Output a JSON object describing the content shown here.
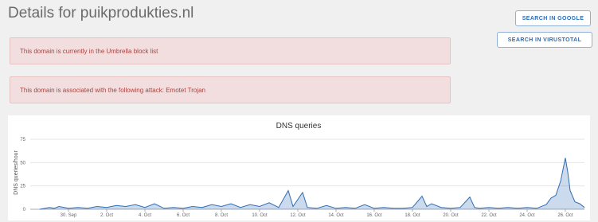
{
  "page": {
    "title": "Details for puikprodukties.nl"
  },
  "buttons": {
    "google": "SEARCH IN GOOGLE",
    "virustotal": "SEARCH IN VIRUSTOTAL"
  },
  "alerts": [
    "This domain is currently in the Umbrella block list",
    "This domain is associated with the following attack: Emotet Trojan"
  ],
  "colors": {
    "alert_bg": "#f2dede",
    "alert_text": "#a94442",
    "button_text": "#2a6db8",
    "series": "#2f6db5"
  },
  "chart_data": {
    "type": "area",
    "title": "DNS queries",
    "xlabel": "",
    "ylabel": "DNS queries/hour",
    "ylim": [
      0,
      75
    ],
    "yticks": [
      0,
      25,
      50,
      75
    ],
    "xlim": [
      "2019-09-28",
      "2019-10-27"
    ],
    "xticks": [
      "30. Sep",
      "2. Oct",
      "4. Oct",
      "6. Oct",
      "8. Oct",
      "10. Oct",
      "12. Oct",
      "14. Oct",
      "16. Oct",
      "18. Oct",
      "20. Oct",
      "22. Oct",
      "24. Oct",
      "26. Oct"
    ],
    "grid": true,
    "legend": "none",
    "series": [
      {
        "values": [
          [
            "2019-09-28T12:00",
            0
          ],
          [
            "2019-09-29T00:00",
            2
          ],
          [
            "2019-09-29T06:00",
            1
          ],
          [
            "2019-09-29T12:00",
            3
          ],
          [
            "2019-09-30T00:00",
            1
          ],
          [
            "2019-09-30T12:00",
            2
          ],
          [
            "2019-10-01T00:00",
            1
          ],
          [
            "2019-10-01T12:00",
            3
          ],
          [
            "2019-10-02T00:00",
            2
          ],
          [
            "2019-10-02T12:00",
            4
          ],
          [
            "2019-10-03T00:00",
            3
          ],
          [
            "2019-10-03T12:00",
            5
          ],
          [
            "2019-10-04T00:00",
            2
          ],
          [
            "2019-10-04T12:00",
            6
          ],
          [
            "2019-10-05T00:00",
            1
          ],
          [
            "2019-10-05T12:00",
            2
          ],
          [
            "2019-10-06T00:00",
            1
          ],
          [
            "2019-10-06T12:00",
            3
          ],
          [
            "2019-10-07T00:00",
            2
          ],
          [
            "2019-10-07T12:00",
            5
          ],
          [
            "2019-10-08T00:00",
            3
          ],
          [
            "2019-10-08T12:00",
            6
          ],
          [
            "2019-10-09T00:00",
            2
          ],
          [
            "2019-10-09T12:00",
            5
          ],
          [
            "2019-10-10T00:00",
            3
          ],
          [
            "2019-10-10T12:00",
            7
          ],
          [
            "2019-10-11T00:00",
            2
          ],
          [
            "2019-10-11T12:00",
            20
          ],
          [
            "2019-10-11T18:00",
            3
          ],
          [
            "2019-10-12T06:00",
            18
          ],
          [
            "2019-10-12T12:00",
            2
          ],
          [
            "2019-10-13T00:00",
            1
          ],
          [
            "2019-10-13T12:00",
            4
          ],
          [
            "2019-10-14T00:00",
            1
          ],
          [
            "2019-10-14T12:00",
            2
          ],
          [
            "2019-10-15T00:00",
            1
          ],
          [
            "2019-10-15T12:00",
            5
          ],
          [
            "2019-10-16T00:00",
            1
          ],
          [
            "2019-10-16T12:00",
            2
          ],
          [
            "2019-10-17T00:00",
            1
          ],
          [
            "2019-10-17T12:00",
            1
          ],
          [
            "2019-10-18T00:00",
            2
          ],
          [
            "2019-10-18T12:00",
            14
          ],
          [
            "2019-10-18T18:00",
            3
          ],
          [
            "2019-10-19T00:00",
            6
          ],
          [
            "2019-10-19T12:00",
            2
          ],
          [
            "2019-10-20T00:00",
            1
          ],
          [
            "2019-10-20T12:00",
            2
          ],
          [
            "2019-10-21T00:00",
            13
          ],
          [
            "2019-10-21T06:00",
            2
          ],
          [
            "2019-10-21T12:00",
            1
          ],
          [
            "2019-10-22T00:00",
            2
          ],
          [
            "2019-10-22T12:00",
            1
          ],
          [
            "2019-10-23T00:00",
            2
          ],
          [
            "2019-10-23T12:00",
            1
          ],
          [
            "2019-10-24T00:00",
            2
          ],
          [
            "2019-10-24T12:00",
            1
          ],
          [
            "2019-10-25T00:00",
            5
          ],
          [
            "2019-10-25T06:00",
            12
          ],
          [
            "2019-10-25T12:00",
            15
          ],
          [
            "2019-10-25T18:00",
            30
          ],
          [
            "2019-10-26T00:00",
            55
          ],
          [
            "2019-10-26T03:00",
            40
          ],
          [
            "2019-10-26T06:00",
            20
          ],
          [
            "2019-10-26T12:00",
            8
          ],
          [
            "2019-10-26T18:00",
            6
          ],
          [
            "2019-10-27T00:00",
            2
          ]
        ]
      }
    ]
  }
}
